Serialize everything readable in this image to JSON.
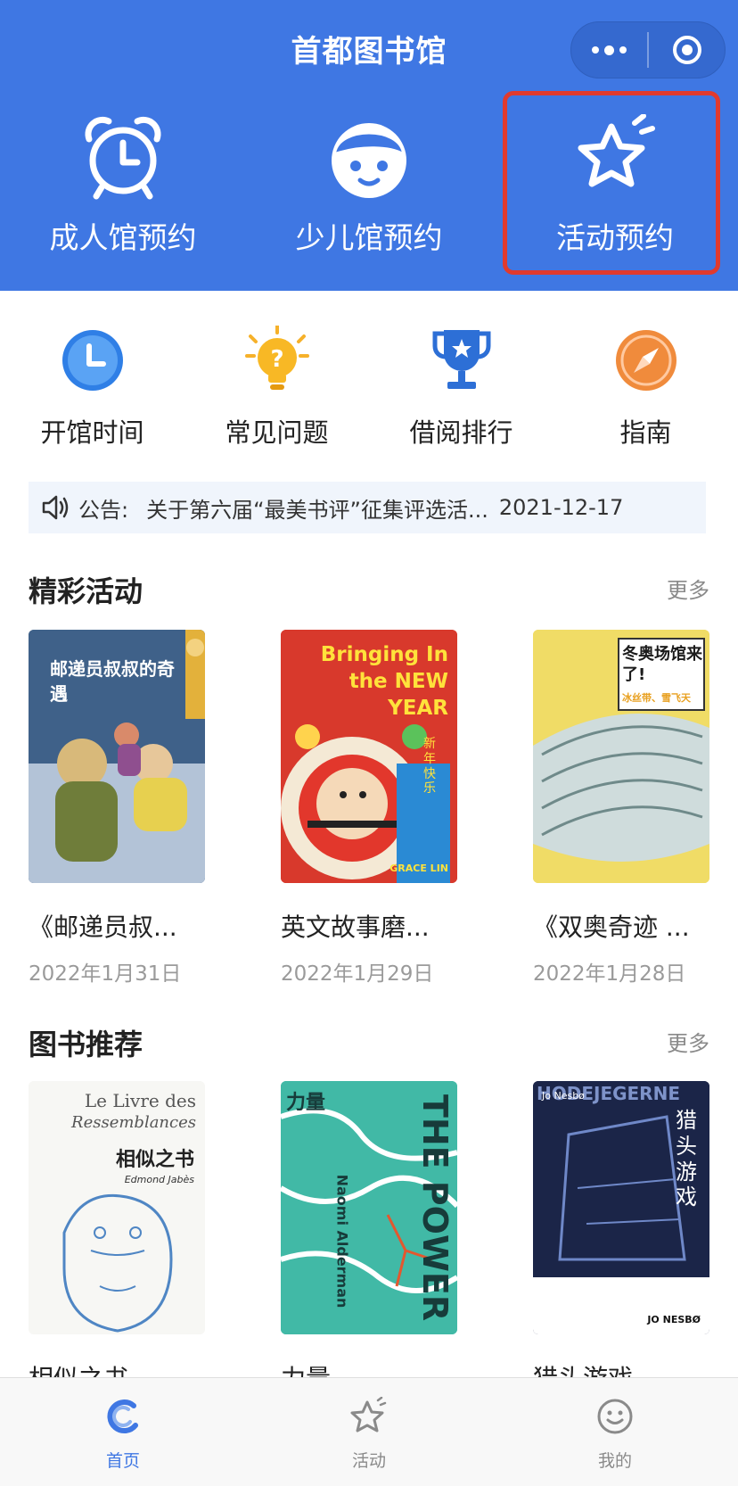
{
  "header": {
    "title": "首都图书馆",
    "quick_actions": [
      {
        "label": "成人馆预约",
        "icon": "alarm-clock-icon"
      },
      {
        "label": "少儿馆预约",
        "icon": "child-face-icon"
      },
      {
        "label": "活动预约",
        "icon": "star-icon"
      }
    ]
  },
  "grid": [
    {
      "label": "开馆时间",
      "icon": "clock-icon"
    },
    {
      "label": "常见问题",
      "icon": "lightbulb-question-icon"
    },
    {
      "label": "借阅排行",
      "icon": "trophy-icon"
    },
    {
      "label": "指南",
      "icon": "compass-icon"
    }
  ],
  "notice": {
    "label": "公告:",
    "text": "关于第六届“最美书评”征集评选活...",
    "date": "2021-12-17"
  },
  "activities": {
    "title": "精彩活动",
    "more": "更多",
    "items": [
      {
        "title": "《邮递员叔...",
        "date": "2022年1月31日",
        "cover_text": "邮递员叔叔的奇遇"
      },
      {
        "title": "英文故事磨...",
        "date": "2022年1月29日",
        "cover_text": "Bringing In the NEW YEAR",
        "cover_sub": "新年快乐",
        "cover_author": "GRACE LIN"
      },
      {
        "title": "《双奥奇迹 ...",
        "date": "2022年1月28日",
        "cover_text": "冬奥场馆来了!",
        "cover_sub": "冰丝带、雪飞天"
      }
    ]
  },
  "books": {
    "title": "图书推荐",
    "more": "更多",
    "items": [
      {
        "title": "相似之书",
        "cover_text": "Le Livre des",
        "cover_text2": "Ressemblances",
        "cover_cn": "相似之书",
        "cover_author": "Edmond Jabès"
      },
      {
        "title": "力量",
        "cover_text": "THE POWER",
        "cover_author": "Naomi Alderman",
        "cover_cn": "力量"
      },
      {
        "title": "猎头游戏",
        "cover_text": "HODEJEGERNE",
        "cover_cn": "猎头游戏",
        "cover_author": "Jo Nesbø",
        "cover_author2": "JO NESBØ"
      }
    ]
  },
  "tabbar": [
    {
      "label": "首页",
      "icon": "home-c-icon",
      "active": true
    },
    {
      "label": "活动",
      "icon": "star-outline-icon",
      "active": false
    },
    {
      "label": "我的",
      "icon": "smiley-icon",
      "active": false
    }
  ],
  "colors": {
    "primary": "#3f77e3",
    "highlight_border": "#e03a2e"
  }
}
